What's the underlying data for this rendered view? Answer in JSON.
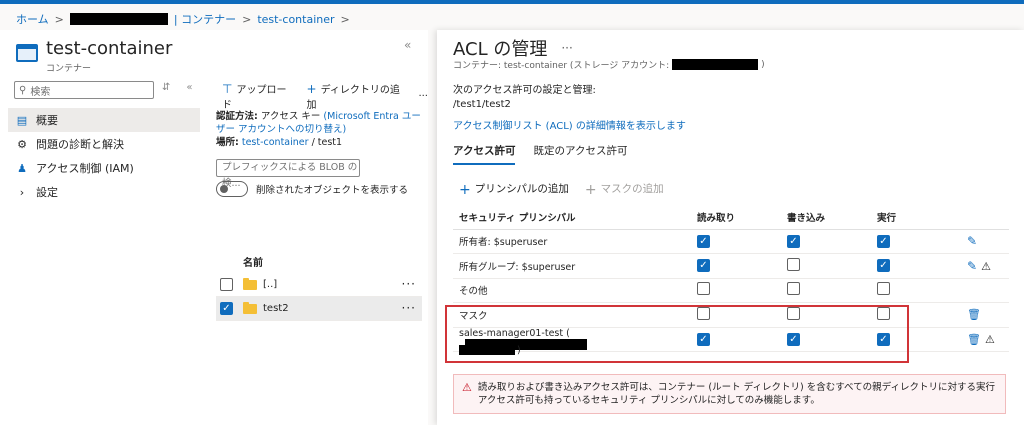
{
  "breadcrumb": {
    "home": "ホーム",
    "sep": ">",
    "container_prefix": "| コンテナー",
    "current": "test-container"
  },
  "left": {
    "title": "test-container",
    "subtitle": "コンテナー",
    "collapse": "«",
    "search_placeholder": "検索",
    "nav": [
      {
        "label": "概要",
        "icon": "overview-icon",
        "active": true
      },
      {
        "label": "問題の診断と解決",
        "icon": "wrench-icon"
      },
      {
        "label": "アクセス制御 (IAM)",
        "icon": "people-icon"
      },
      {
        "label": "設定",
        "icon": "chevron-right-icon"
      }
    ],
    "toolbar": {
      "upload": "アップロード",
      "add_dir": "ディレクトリの追加",
      "more": "···"
    },
    "auth": {
      "label": "認証方法:",
      "value": "アクセス キー",
      "switch_link": "(Microsoft Entra ユーザー アカウントへの切り替え)",
      "location_label": "場所:",
      "location_link": "test-container",
      "location_rest": "/ test1"
    },
    "prefix_placeholder": "プレフィックスによる BLOB の検...",
    "toggle_label": "削除されたオブジェクトを表示する",
    "name_header": "名前",
    "files": [
      {
        "name": "[..]",
        "checked": false
      },
      {
        "name": "test2",
        "checked": true
      }
    ]
  },
  "right": {
    "title": "ACL の管理",
    "dots": "···",
    "subtitle_prefix": "コンテナー: test-container (ストレージ アカウント:",
    "subtitle_suffix": ")",
    "desc_line1": "次のアクセス許可の設定と管理:",
    "desc_line2": "/test1/test2",
    "link": "アクセス制御リスト (ACL) の詳細情報を表示します",
    "tabs": [
      "アクセス許可",
      "既定のアクセス許可"
    ],
    "actions": {
      "add_principal": "プリンシパルの追加",
      "add_mask": "マスクの追加"
    },
    "columns": [
      "セキュリティ プリンシパル",
      "読み取り",
      "書き込み",
      "実行"
    ],
    "rows": [
      {
        "principal": "所有者: $superuser",
        "read": true,
        "write": true,
        "exec": true,
        "edit": true,
        "warn": false,
        "trash": false
      },
      {
        "principal": "所有グループ: $superuser",
        "read": true,
        "write": false,
        "exec": true,
        "edit": true,
        "warn": true,
        "trash": false
      },
      {
        "principal": "その他",
        "read": false,
        "write": false,
        "exec": false,
        "edit": false,
        "warn": false,
        "trash": false
      },
      {
        "principal": "マスク",
        "read": false,
        "write": false,
        "exec": false,
        "edit": false,
        "warn": false,
        "trash": true
      },
      {
        "principal": "sales-manager01-test (",
        "read": true,
        "write": true,
        "exec": true,
        "edit": false,
        "warn": true,
        "trash": true
      }
    ],
    "warning": "読み取りおよび書き込みアクセス許可は、コンテナー (ルート ディレクトリ) を含むすべての親ディレクトリに対する実行アクセス許可も持っているセキュリティ プリンシパルに対してのみ機能します。",
    "closing_paren": ")"
  },
  "colors": {
    "accent": "#0f6cbd",
    "highlight": "#d13438"
  }
}
